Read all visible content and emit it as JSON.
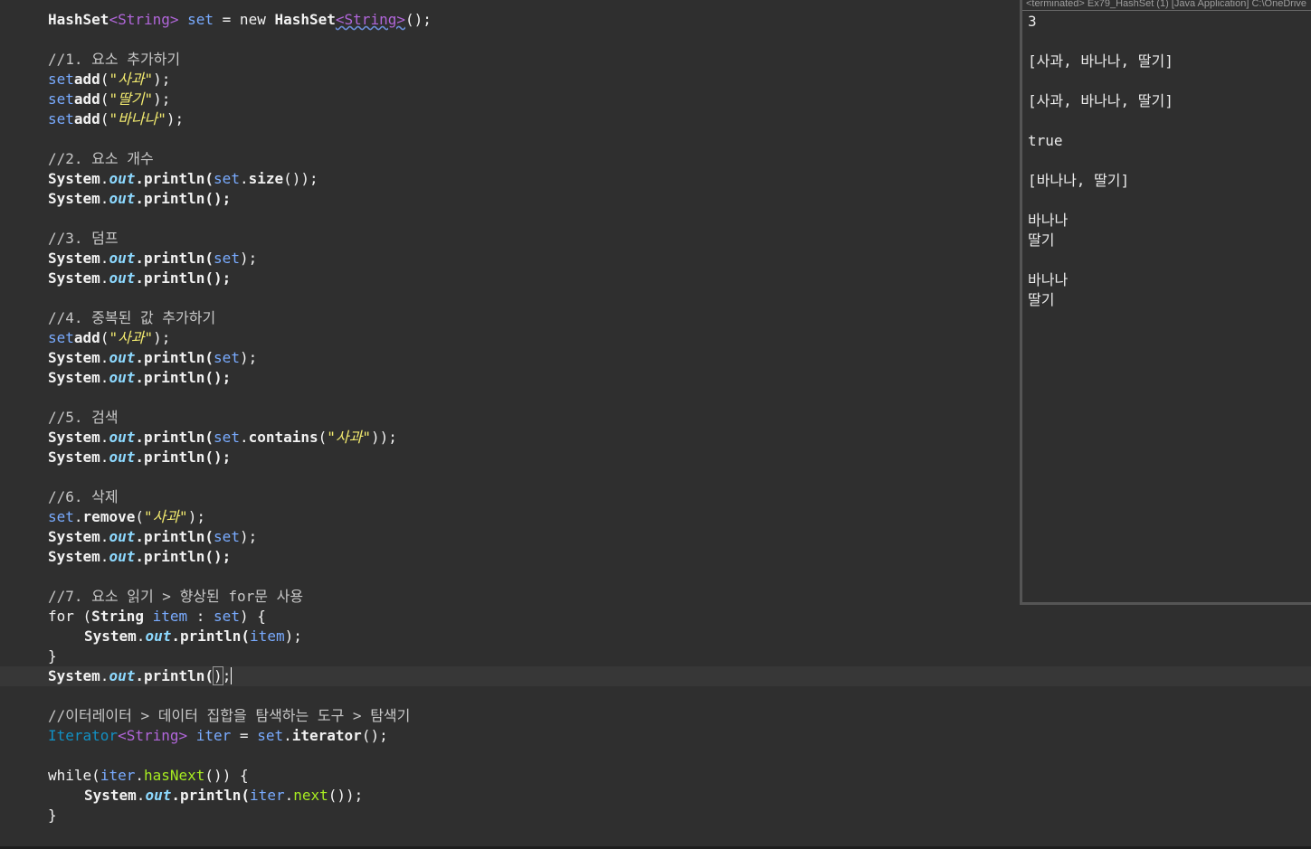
{
  "editor": {
    "line1": {
      "a": "HashSet",
      "b": "<String>",
      "c": " set",
      "d": " = new ",
      "e": "HashSet",
      "f": "<String>",
      "g": "();"
    },
    "c1": "//1. 요소 추가하기",
    "add1": {
      "a": "set",
      ".": ".",
      "m": "add",
      "o": "(",
      "s": "\"사과\"",
      "c": ");"
    },
    "add2": {
      "a": "set",
      ".": ".",
      "m": "add",
      "o": "(",
      "s": "\"딸기\"",
      "c": ");"
    },
    "add3": {
      "a": "set",
      ".": ".",
      "m": "add",
      "o": "(",
      "s": "\"바나나\"",
      "c": ");"
    },
    "c2": "//2. 요소 개수",
    "p_size": {
      "sys": "System",
      "dot": ".",
      "out": "out",
      "pl": ".println(",
      "arg": "set",
      "d2": ".",
      "m": "size",
      "c": "());"
    },
    "println_empty": {
      "sys": "System",
      "dot": ".",
      "out": "out",
      "pl": ".println();"
    },
    "c3": "//3. 덤프",
    "p_set": {
      "sys": "System",
      "dot": ".",
      "out": "out",
      "pl": ".println(",
      "arg": "set",
      "c": ");"
    },
    "c4": "//4. 중복된 값 추가하기",
    "c5": "//5. 검색",
    "p_contains": {
      "sys": "System",
      "dot": ".",
      "out": "out",
      "pl": ".println(",
      "arg": "set",
      "d2": ".",
      "m": "contains",
      "o": "(",
      "s": "\"사과\"",
      "c": "));"
    },
    "c6": "//6. 삭제",
    "remove": {
      "a": "set",
      "dot": ".",
      "m": "remove",
      "o": "(",
      "s": "\"사과\"",
      "c": ");"
    },
    "c7": "//7. 요소 읽기 > 향상된 for문 사용",
    "forline": {
      "kw": "for",
      "sp": " (",
      "t": "String",
      "v": " item",
      "col": " : ",
      "set": "set",
      "c": ") {"
    },
    "forbody": {
      "sys": "System",
      "dot": ".",
      "out": "out",
      "pl": ".println(",
      "arg": "item",
      "c": ");"
    },
    "close": "}",
    "cur": {
      "sys": "System",
      "dot": ".",
      "out": "out",
      "pl": ".println(",
      "p": ")",
      ";": ";"
    },
    "c8": "//이터레이터 > 데이터 집합을 탐색하는 도구 > 탐색기",
    "iter": {
      "t": "Iterator",
      "g": "<String>",
      "v": " iter",
      "eq": " = ",
      "set": "set",
      "dot": ".",
      "m": "iterator",
      "c": "();"
    },
    "while": {
      "kw": "while",
      "o": "(",
      "v": "iter",
      "dot": ".",
      "m": "hasNext",
      "c": "()) {"
    },
    "whilebody": {
      "sys": "System",
      "dot": ".",
      "out": "out",
      "pl": ".println(",
      "v": "iter",
      "d2": ".",
      "m": "next",
      "c": "());"
    }
  },
  "console": {
    "title": "<terminated> Ex79_HashSet (1) [Java Application] C:\\OneDrive",
    "lines": [
      "3",
      "[사과, 바나나, 딸기]",
      "[사과, 바나나, 딸기]",
      "true",
      "[바나나, 딸기]",
      "바나나",
      "딸기",
      "바나나",
      "딸기"
    ]
  }
}
